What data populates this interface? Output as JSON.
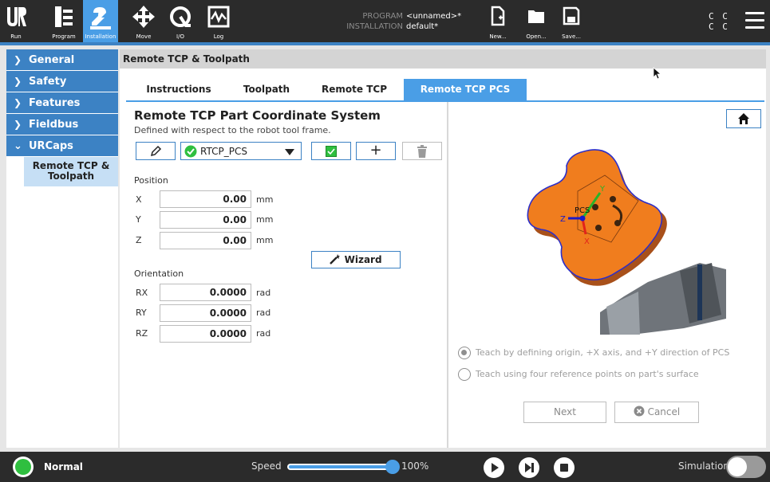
{
  "header": {
    "nav": [
      {
        "label": "Run",
        "icon": "ur-logo-icon"
      },
      {
        "label": "Program",
        "icon": "program-icon"
      },
      {
        "label": "Installation",
        "icon": "installation-icon"
      },
      {
        "label": "Move",
        "icon": "move-icon"
      },
      {
        "label": "I/O",
        "icon": "io-icon"
      },
      {
        "label": "Log",
        "icon": "log-icon"
      }
    ],
    "program_key": "PROGRAM",
    "program_value": "<unnamed>*",
    "installation_key": "INSTALLATION",
    "installation_value": "default*",
    "file_buttons": [
      {
        "label": "New...",
        "icon": "new-file-icon"
      },
      {
        "label": "Open...",
        "icon": "open-folder-icon"
      },
      {
        "label": "Save...",
        "icon": "save-icon"
      }
    ],
    "cc_line1": "C C",
    "cc_line2": "C C"
  },
  "sidebar": {
    "items": [
      {
        "label": "General",
        "expanded": false
      },
      {
        "label": "Safety",
        "expanded": false
      },
      {
        "label": "Features",
        "expanded": false
      },
      {
        "label": "Fieldbus",
        "expanded": false
      },
      {
        "label": "URCaps",
        "expanded": true
      }
    ],
    "sub_item": "Remote TCP & Toolpath"
  },
  "main": {
    "title": "Remote TCP & Toolpath",
    "tabs": [
      "Instructions",
      "Toolpath",
      "Remote TCP",
      "Remote TCP PCS"
    ],
    "active_tab": 3,
    "heading": "Remote TCP Part Coordinate System",
    "subheading": "Defined with respect to the robot tool frame.",
    "pcs_select": "RTCP_PCS",
    "position_label": "Position",
    "position": [
      {
        "axis": "X",
        "value": "0.00",
        "unit": "mm"
      },
      {
        "axis": "Y",
        "value": "0.00",
        "unit": "mm"
      },
      {
        "axis": "Z",
        "value": "0.00",
        "unit": "mm"
      }
    ],
    "wizard_label": "Wizard",
    "orientation_label": "Orientation",
    "orientation": [
      {
        "axis": "RX",
        "value": "0.0000",
        "unit": "rad"
      },
      {
        "axis": "RY",
        "value": "0.0000",
        "unit": "rad"
      },
      {
        "axis": "RZ",
        "value": "0.0000",
        "unit": "rad"
      }
    ],
    "diagram_labels": {
      "pcs": "PCS",
      "x": "X",
      "y": "Y",
      "z": "Z"
    },
    "radio_options": [
      {
        "label": "Teach by defining origin, +X axis, and +Y direction of PCS",
        "selected": true
      },
      {
        "label": "Teach using four reference points on part's surface",
        "selected": false
      }
    ],
    "next_label": "Next",
    "cancel_label": "Cancel"
  },
  "footer": {
    "status": "Normal",
    "speed_label": "Speed",
    "speed_percent": 100,
    "speed_text": "100%",
    "simulation_label": "Simulation",
    "simulation_on": false
  },
  "colors": {
    "accent": "#3c82c4",
    "tab_active": "#4a9ee6",
    "header_bg": "#2b2b2b",
    "status_green": "#2fbf3f",
    "part_orange": "#f07d1e"
  }
}
